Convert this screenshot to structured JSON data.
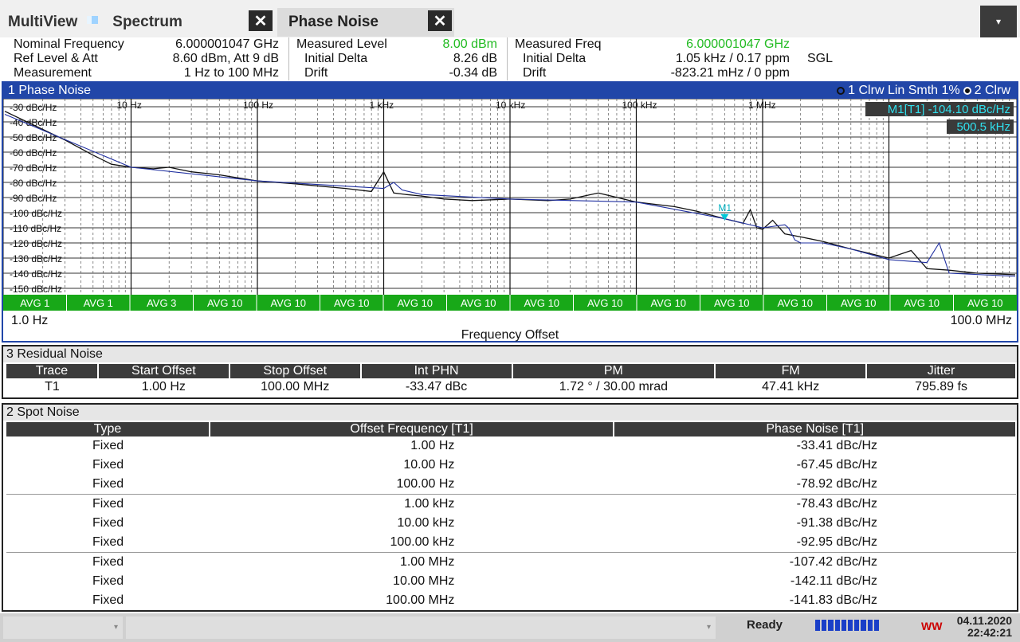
{
  "tabs": {
    "multiview": "MultiView",
    "spectrum": "Spectrum",
    "phase_noise": "Phase Noise",
    "close_glyph": "✕",
    "menu_glyph": "▾"
  },
  "info": {
    "nominal_frequency_label": "Nominal Frequency",
    "nominal_frequency_value": "6.000001047 GHz",
    "ref_level_label": "Ref Level & Att",
    "ref_level_value": "8.60 dBm, Att 9 dB",
    "measurement_label": "Measurement",
    "measurement_value": "1 Hz to 100 MHz",
    "measured_level_label": "Measured Level",
    "measured_level_value": "8.00 dBm",
    "level_initial_delta_label": "Initial Delta",
    "level_initial_delta_value": "8.26 dB",
    "level_drift_label": "Drift",
    "level_drift_value": "-0.34 dB",
    "measured_freq_label": "Measured Freq",
    "measured_freq_value": "6.000001047 GHz",
    "freq_initial_delta_label": "Initial Delta",
    "freq_initial_delta_value": "1.05 kHz / 0.17 ppm",
    "freq_drift_label": "Drift",
    "freq_drift_value": "-823.21 mHz / 0 ppm",
    "sgl": "SGL"
  },
  "window1": {
    "title": "1 Phase Noise",
    "trace1_legend": "1 Clrw Lin Smth 1%",
    "trace2_legend": "2 Clrw",
    "x_start": "1.0 Hz",
    "x_stop": "100.0 MHz",
    "x_label": "Frequency Offset",
    "marker_label": "M1[T1]",
    "marker_value": "-104.10 dBc/Hz",
    "marker_freq": "500.5 kHz",
    "marker_tag": "M1"
  },
  "chart_data": {
    "type": "line",
    "x_scale": "log",
    "xlim": [
      1,
      100000000
    ],
    "ylim": [
      -150,
      -30
    ],
    "x_tick_labels": [
      "10 Hz",
      "100 Hz",
      "1 kHz",
      "10 kHz",
      "100 kHz",
      "1 MHz"
    ],
    "x_ticks": [
      10,
      100,
      1000,
      10000,
      100000,
      1000000
    ],
    "y_ticks": [
      -30,
      -40,
      -50,
      -60,
      -70,
      -80,
      -90,
      -100,
      -110,
      -120,
      -130,
      -140,
      -150
    ],
    "y_tick_labels": [
      "-30 dBc/Hz",
      "-40 dBc/Hz",
      "-50 dBc/Hz",
      "-60 dBc/Hz",
      "-70 dBc/Hz",
      "-80 dBc/Hz",
      "-90 dBc/Hz",
      "-100 dBc/Hz",
      "-110 dBc/Hz",
      "-120 dBc/Hz",
      "-130 dBc/Hz",
      "-140 dBc/Hz",
      "-150 dBc/Hz"
    ],
    "avg_labels": [
      "AVG 1",
      "AVG 1",
      "AVG 3",
      "AVG 10",
      "AVG 10",
      "AVG 10",
      "AVG 10",
      "AVG 10",
      "AVG 10",
      "AVG 10",
      "AVG 10",
      "AVG 10",
      "AVG 10",
      "AVG 10",
      "AVG 10",
      "AVG 10"
    ],
    "grid": true,
    "series": [
      {
        "color": "#111111",
        "x": [
          1,
          2,
          3,
          5,
          7,
          10,
          15,
          20,
          30,
          50,
          70,
          100,
          200,
          500,
          800,
          1000,
          1200,
          1500,
          2000,
          3000,
          5000,
          10000,
          20000,
          30000,
          50000,
          100000,
          200000,
          300000,
          500000,
          700000,
          800000,
          900000,
          1000000,
          1200000,
          1500000,
          2000000,
          3000000,
          5000000,
          10000000,
          15000000,
          20000000,
          30000000,
          50000000,
          100000000
        ],
        "y": [
          -33,
          -45,
          -52,
          -62,
          -68,
          -70,
          -71,
          -70,
          -73,
          -75,
          -77,
          -79,
          -81,
          -84,
          -86,
          -73,
          -87,
          -88,
          -89,
          -91,
          -92,
          -91,
          -92,
          -91,
          -87,
          -93,
          -96,
          -99,
          -104,
          -107,
          -98,
          -110,
          -111,
          -105,
          -114,
          -116,
          -119,
          -124,
          -130,
          -125,
          -137,
          -138,
          -140,
          -141
        ]
      },
      {
        "color": "#1f2fa0",
        "x": [
          1,
          10,
          100,
          1000,
          1200,
          1400,
          2000,
          10000,
          100000,
          500000,
          1000000,
          1500000,
          1600000,
          1800000,
          2000000,
          3000000,
          5000000,
          10000000,
          20000000,
          25000000,
          30000000,
          100000000
        ],
        "y": [
          -35,
          -70,
          -79,
          -84,
          -80,
          -85,
          -88,
          -91,
          -93,
          -104,
          -110,
          -108,
          -110,
          -118,
          -120,
          -120,
          -124,
          -131,
          -133,
          -120,
          -140,
          -142
        ]
      }
    ]
  },
  "residual": {
    "title": "3 Residual Noise",
    "headers": [
      "Trace",
      "Start Offset",
      "Stop Offset",
      "Int PHN",
      "PM",
      "FM",
      "Jitter"
    ],
    "row": [
      "T1",
      "1.00 Hz",
      "100.00 MHz",
      "-33.47 dBc",
      "1.72 °  / 30.00 mrad",
      "47.41 kHz",
      "795.89 fs"
    ]
  },
  "spot": {
    "title": "2 Spot Noise",
    "headers": [
      "Type",
      "Offset Frequency [T1]",
      "Phase Noise [T1]"
    ],
    "rows": [
      [
        "Fixed",
        "1.00 Hz",
        "-33.41 dBc/Hz"
      ],
      [
        "Fixed",
        "10.00 Hz",
        "-67.45 dBc/Hz"
      ],
      [
        "Fixed",
        "100.00 Hz",
        "-78.92 dBc/Hz"
      ],
      [
        "Fixed",
        "1.00 kHz",
        "-78.43 dBc/Hz"
      ],
      [
        "Fixed",
        "10.00 kHz",
        "-91.38 dBc/Hz"
      ],
      [
        "Fixed",
        "100.00 kHz",
        "-92.95 dBc/Hz"
      ],
      [
        "Fixed",
        "1.00 MHz",
        "-107.42 dBc/Hz"
      ],
      [
        "Fixed",
        "10.00 MHz",
        "-142.11 dBc/Hz"
      ],
      [
        "Fixed",
        "100.00 MHz",
        "-141.83 dBc/Hz"
      ]
    ]
  },
  "status": {
    "ready": "Ready",
    "date": "04.11.2020",
    "time": "22:42:21",
    "dropdown_glyph": "▾",
    "warn": "WW"
  }
}
